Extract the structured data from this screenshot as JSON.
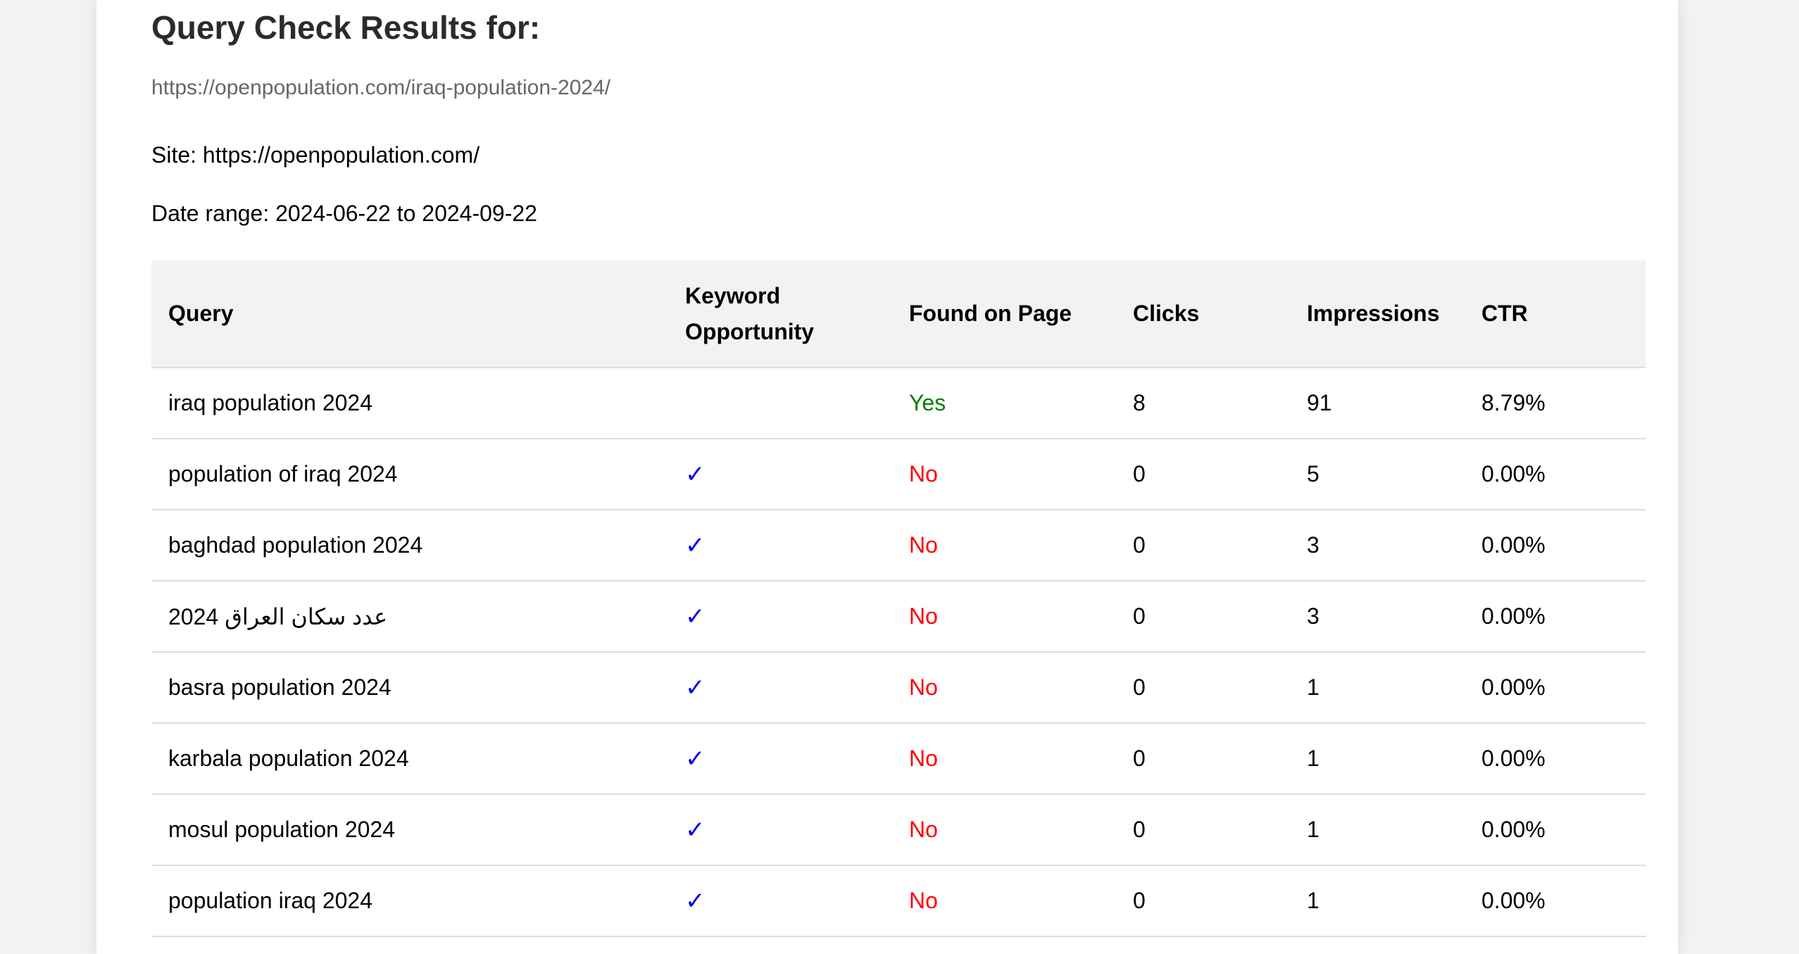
{
  "heading": "Query Check Results for:",
  "url": "https://openpopulation.com/iraq-population-2024/",
  "site_label": "Site: https://openpopulation.com/",
  "date_range_label": "Date range: 2024-06-22 to 2024-09-22",
  "table": {
    "headers": {
      "query": "Query",
      "keyword_line1": "Keyword",
      "keyword_line2": "Opportunity",
      "found": "Found on Page",
      "clicks": "Clicks",
      "impressions": "Impressions",
      "ctr": "CTR"
    },
    "rows": [
      {
        "query": "iraq population 2024",
        "keyword": "",
        "found": "Yes",
        "clicks": "8",
        "impressions": "91",
        "ctr": "8.79%"
      },
      {
        "query": "population of iraq 2024",
        "keyword": "✓",
        "found": "No",
        "clicks": "0",
        "impressions": "5",
        "ctr": "0.00%"
      },
      {
        "query": "baghdad population 2024",
        "keyword": "✓",
        "found": "No",
        "clicks": "0",
        "impressions": "3",
        "ctr": "0.00%"
      },
      {
        "query": "عدد سكان العراق 2024",
        "keyword": "✓",
        "found": "No",
        "clicks": "0",
        "impressions": "3",
        "ctr": "0.00%"
      },
      {
        "query": "basra population 2024",
        "keyword": "✓",
        "found": "No",
        "clicks": "0",
        "impressions": "1",
        "ctr": "0.00%"
      },
      {
        "query": "karbala population 2024",
        "keyword": "✓",
        "found": "No",
        "clicks": "0",
        "impressions": "1",
        "ctr": "0.00%"
      },
      {
        "query": "mosul population 2024",
        "keyword": "✓",
        "found": "No",
        "clicks": "0",
        "impressions": "1",
        "ctr": "0.00%"
      },
      {
        "query": "population iraq 2024",
        "keyword": "✓",
        "found": "No",
        "clicks": "0",
        "impressions": "1",
        "ctr": "0.00%"
      }
    ]
  },
  "colors": {
    "yes": "#008000",
    "no": "#ff0000",
    "check": "#0000ee",
    "header_bg": "#f2f2f2",
    "row_border": "#dddddd"
  }
}
